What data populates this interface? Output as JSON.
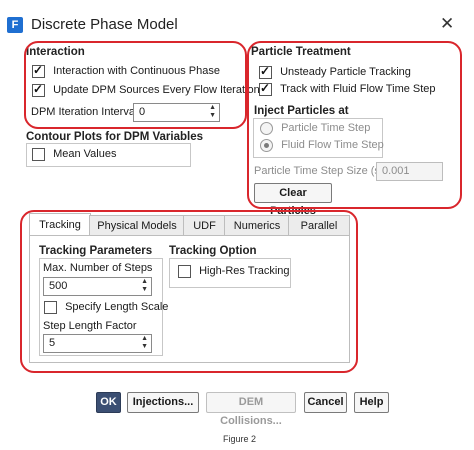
{
  "window": {
    "title": "Discrete Phase Model",
    "icon_letter": "F",
    "close_glyph": "✕"
  },
  "interaction": {
    "title": "Interaction",
    "continuous_phase": {
      "label": "Interaction with Continuous Phase",
      "checked": true
    },
    "update_sources": {
      "label": "Update DPM Sources Every Flow Iteration",
      "checked": true
    },
    "iteration_interval": {
      "label": "DPM Iteration Interval",
      "value": "0"
    }
  },
  "contour": {
    "title": "Contour Plots for DPM Variables",
    "mean_values": {
      "label": "Mean Values",
      "checked": false
    }
  },
  "particle_treatment": {
    "title": "Particle Treatment",
    "unsteady": {
      "label": "Unsteady Particle Tracking",
      "checked": true
    },
    "track_fluid": {
      "label": "Track with Fluid Flow Time Step",
      "checked": true
    },
    "inject_title": "Inject Particles at",
    "radio_particle": {
      "label": "Particle Time Step",
      "checked": false
    },
    "radio_fluid": {
      "label": "Fluid Flow Time Step",
      "checked": true
    },
    "time_step_size": {
      "label": "Particle Time Step Size (s)",
      "value": "0.001"
    },
    "clear_button": "Clear Particles"
  },
  "tabs": [
    {
      "label": "Tracking",
      "active": true
    },
    {
      "label": "Physical Models",
      "active": false
    },
    {
      "label": "UDF",
      "active": false
    },
    {
      "label": "Numerics",
      "active": false
    },
    {
      "label": "Parallel",
      "active": false
    }
  ],
  "tracking": {
    "params_title": "Tracking Parameters",
    "max_steps": {
      "label": "Max. Number of Steps",
      "value": "500"
    },
    "specify_length": {
      "label": "Specify Length Scale",
      "checked": false
    },
    "step_length": {
      "label": "Step Length Factor",
      "value": "5"
    },
    "option_title": "Tracking Option",
    "high_res": {
      "label": "High-Res Tracking",
      "checked": false
    }
  },
  "buttons": {
    "ok": "OK",
    "injections": "Injections...",
    "dem": "DEM Collisions...",
    "cancel": "Cancel",
    "help": "Help"
  },
  "caption": "Figure 2",
  "colors": {
    "highlight": "#d9262c",
    "primary_button": "#3b4f73",
    "app_icon": "#1f6fd1"
  }
}
